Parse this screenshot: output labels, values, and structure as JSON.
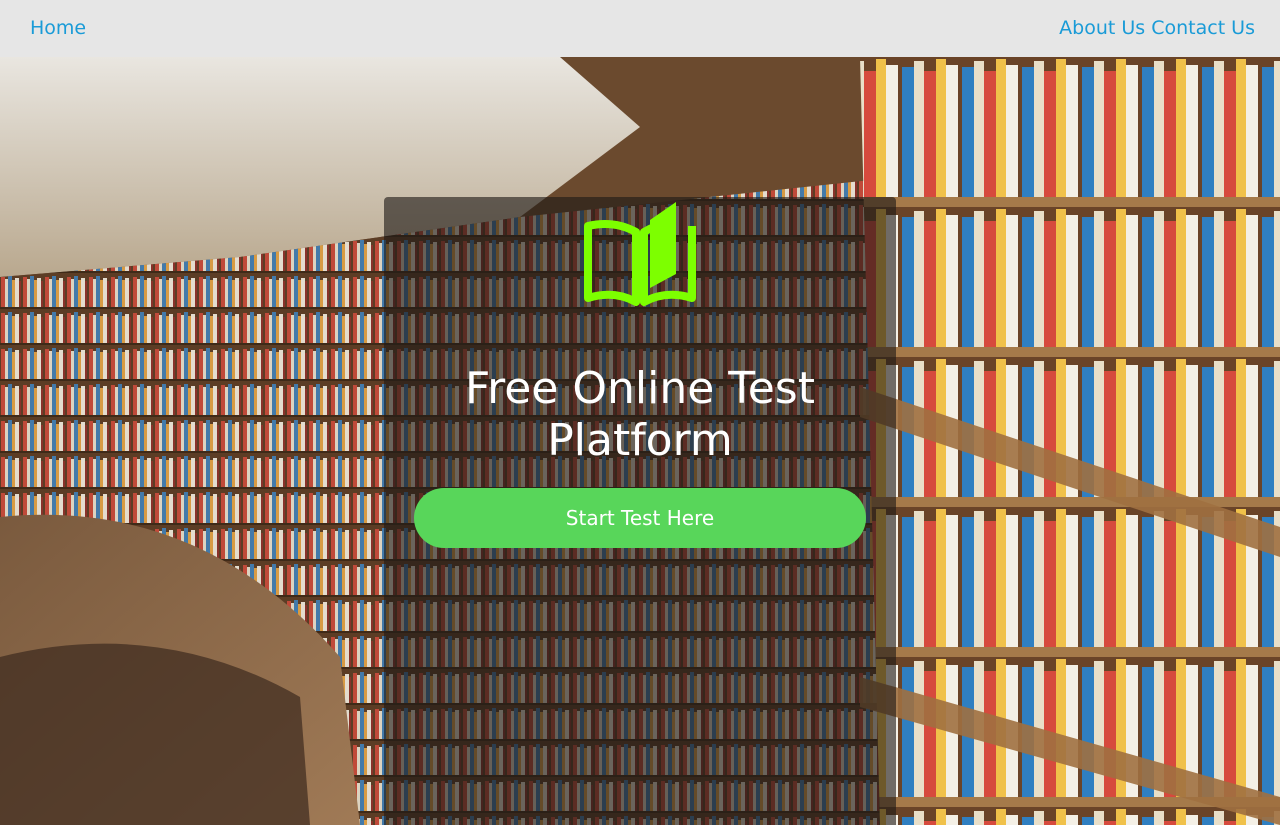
{
  "nav": {
    "home_label": "Home",
    "about_label": "About Us",
    "contact_label": "Contact Us"
  },
  "hero": {
    "logo_icon": "open-book-icon",
    "title": "Free Online Test Platform",
    "start_button_label": "Start Test Here"
  },
  "colors": {
    "nav_background": "#e6e6e6",
    "nav_link": "#1a9bd7",
    "logo_green": "#7dff00",
    "button_green": "#58d65a",
    "panel_overlay": "rgba(30,26,22,0.62)"
  }
}
